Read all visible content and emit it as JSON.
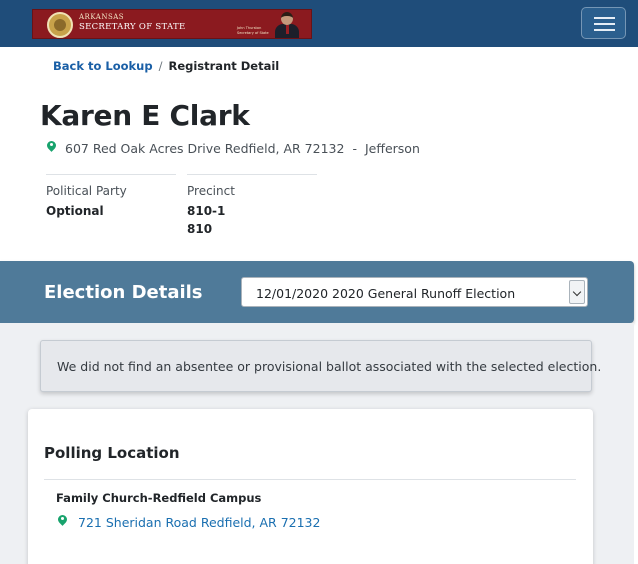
{
  "header": {
    "logo": {
      "line1": "ARKANSAS",
      "line2": "SECRETARY OF STATE",
      "official_line1": "John Thurston",
      "official_line2": "Secretary of State"
    },
    "menu_icon": "hamburger-icon"
  },
  "breadcrumb": {
    "back_link": "Back to Lookup",
    "separator": "/",
    "current": "Registrant Detail"
  },
  "registrant": {
    "name": "Karen E Clark",
    "address": "607 Red Oak Acres Drive Redfield, AR 72132",
    "address_separator": "-",
    "county": "Jefferson",
    "party_label": "Political Party",
    "party_value": "Optional",
    "precinct_label": "Precinct",
    "precinct_values": [
      "810-1",
      "810"
    ]
  },
  "election": {
    "title": "Election Details",
    "selected": "12/01/2020 2020 General Runoff Election"
  },
  "alert_message": "We did not find an absentee or provisional ballot associated with the selected election.",
  "polling": {
    "title": "Polling Location",
    "name": "Family Church-Redfield Campus",
    "address": "721 Sheridan Road Redfield, AR 72132"
  },
  "colors": {
    "navbar": "#1f4d7a",
    "logo_banner": "#8b1a1f",
    "election_bar": "#4f7a99",
    "link": "#1a5fa6",
    "pin": "#18a36d"
  }
}
